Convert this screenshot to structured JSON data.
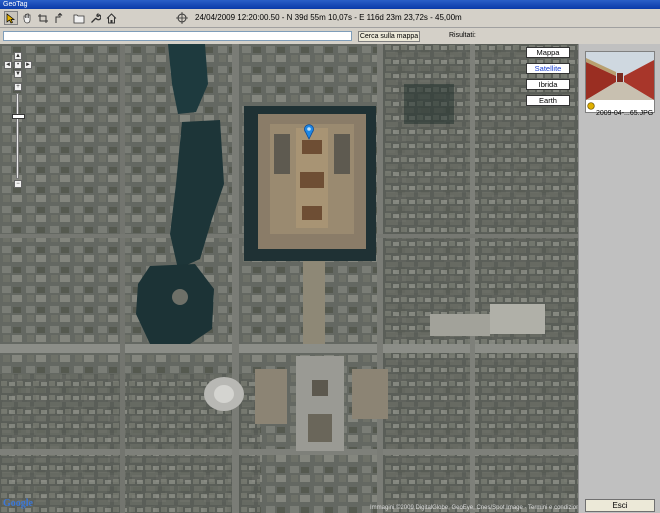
{
  "window": {
    "title": "GeoTag"
  },
  "toolbar": {
    "coordinates": "24/04/2009 12:20:00.50 - N 39d 55m 10,07s - E 116d 23m 23,72s - 45,00m",
    "tools": [
      {
        "icon": "pointer-icon"
      },
      {
        "icon": "hand-icon"
      },
      {
        "icon": "crop-icon"
      },
      {
        "icon": "route-icon"
      },
      {
        "icon": "folder-icon"
      },
      {
        "icon": "wrench-icon"
      },
      {
        "icon": "home-icon"
      },
      {
        "icon": "crosshair-icon"
      }
    ]
  },
  "search": {
    "value": "",
    "button_label": "Cerca sulla mappa",
    "results_label": "Risultati:"
  },
  "map": {
    "types": [
      {
        "label": "Mappa",
        "selected": false
      },
      {
        "label": "Satellite",
        "selected": true
      },
      {
        "label": "Ibrida",
        "selected": false
      },
      {
        "label": "Earth",
        "selected": false
      }
    ],
    "attribution": "Immagini ©2009 DigitalGlobe, GeoEye, Cnes/Spot Image - Termini e condizioni d'uso",
    "logo_text": "Google"
  },
  "photos": {
    "items": [
      {
        "caption": "2009-04-...65.JPG"
      }
    ]
  },
  "footer": {
    "exit_label": "Esci"
  },
  "colors": {
    "titlebar": "#0a3aa8",
    "selected_map_type": "#1a3fd0",
    "pin": "#1e88e5"
  }
}
